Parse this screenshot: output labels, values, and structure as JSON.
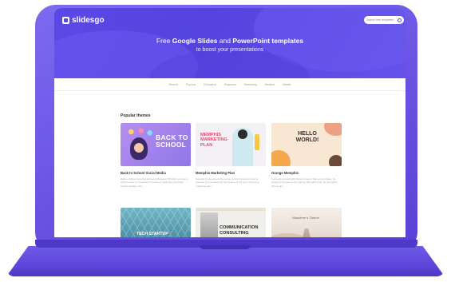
{
  "app": {
    "brand": "slidesgo",
    "search_placeholder": "Search free templates"
  },
  "hero": {
    "title_prefix": "Free ",
    "title_strong1": "Google Slides",
    "title_mid": " and ",
    "title_strong2": "PowerPoint templates",
    "subtitle": "to boost your presentations"
  },
  "categories": [
    "Recent",
    "Popular",
    "Education",
    "Business",
    "Marketing",
    "Medical",
    "Infinite"
  ],
  "section": {
    "title": "Popular themes"
  },
  "cards": [
    {
      "title": "Back to School Social Media",
      "desc": "Back to School time has arrived at Slidesgo! Whether you are a school owner or a business focused on stationery and other school supplies, this...",
      "thumb_text": "BACK TO SCHOOL"
    },
    {
      "title": "Memphis Marketing Plan",
      "desc": "Summer is just around the corner, so it's the perfect time to promote your products for the season of the year. Present a marketing plan...",
      "thumb_text": "MEMPHIS MARKETING PLAN"
    },
    {
      "title": "Orange Memphis",
      "desc": "Surround yourself with vibrant tones in this new template. Its design is focused on the popular Memphis style, so you will be able to get...",
      "thumb_text": "HELLO WORLD!"
    },
    {
      "title": "",
      "desc": "",
      "thumb_text": "TECH STARTUP"
    },
    {
      "title": "",
      "desc": "",
      "thumb_text": "COMMUNICATION CONSULTING"
    },
    {
      "title": "",
      "desc": "",
      "thumb_text": "Wanderer's Theme"
    }
  ],
  "colors": {
    "brand": "#5b49e6",
    "laptop": "#6a52e2"
  }
}
